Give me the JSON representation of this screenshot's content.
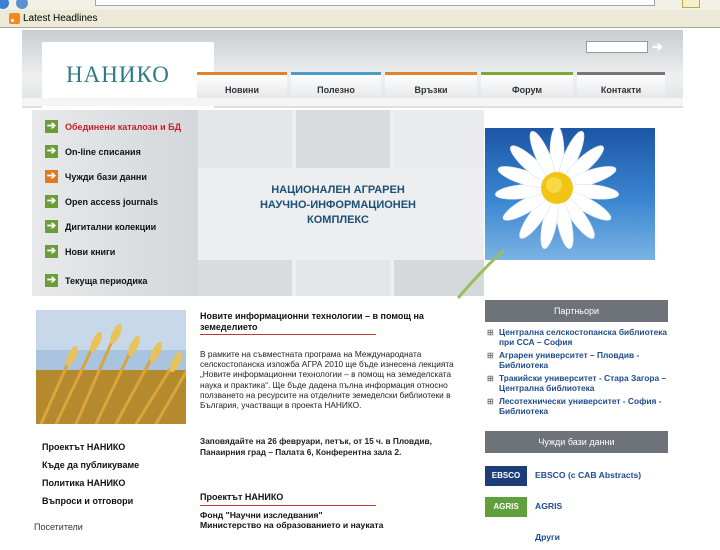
{
  "browser": {
    "favorites_link": "Latest Headlines"
  },
  "site": {
    "logo": "НАНИКО",
    "nav": [
      {
        "label": "Новини",
        "color": "#e0832a"
      },
      {
        "label": "Полезно",
        "color": "#4b9cc6"
      },
      {
        "label": "Връзки",
        "color": "#e0832a"
      },
      {
        "label": "Форум",
        "color": "#7aaa3a"
      },
      {
        "label": "Контакти",
        "color": "#777777"
      }
    ],
    "menu": [
      {
        "label": "Обединени каталози и БД",
        "icon": "arrow-right-icon",
        "color": "#c8202a",
        "arrow_color": "#6a9d3a"
      },
      {
        "label": "On-line списания",
        "icon": "arrow-right-icon",
        "color": "#111111",
        "arrow_color": "#6a9d3a"
      },
      {
        "label": "Чужди бази данни",
        "icon": "arrow-right-icon",
        "color": "#111111",
        "arrow_color": "#e07a1f"
      },
      {
        "label": "Open access journals",
        "icon": "arrow-right-icon",
        "color": "#111111",
        "arrow_color": "#6a9d3a"
      },
      {
        "label": "Дигитални колекции",
        "icon": "arrow-right-icon",
        "color": "#111111",
        "arrow_color": "#6a9d3a"
      },
      {
        "label": "Нови книги",
        "icon": "arrow-right-icon",
        "color": "#111111",
        "arrow_color": "#6a9d3a"
      },
      {
        "label": "Текуща периодика",
        "icon": "arrow-right-icon",
        "color": "#111111",
        "arrow_color": "#6a9d3a"
      }
    ],
    "banner": {
      "line1": "НАЦИОНАЛЕН АГРАРЕН",
      "line2": "НАУЧНО-ИНФОРМАЦИОНЕН",
      "line3": "КОМПЛЕКС"
    },
    "side_links": [
      "Проектът НАНИКО",
      "Къде да публикуваме",
      "Политика НАНИКО",
      "Въпроси и отговори"
    ],
    "bottom_left": "Посетители",
    "news": {
      "title": "Новите информационни технологии – в помощ на земеделието",
      "body": "В рамките на съвместната програма на Международната селскостопанска изложба АГРА 2010 ще бъде изнесена лекцията „Новите информационни технологии – в помощ на земеделската наука и практика“. Ще бъде дадена пълна информация относно ползването на ресурсите на отделните земеделски библиотеки в България, участващи в проекта НАНИКО.",
      "note": "Заповядайте на 26 февруари, петък, от 15 ч. в Пловдив, Панаирния град – Палата 6, Конферентна зала 2."
    },
    "project": {
      "title": "Проектът НАНИКО",
      "line1": "Фонд \"Научни изследвания\"",
      "line2": "Министерство на образованието и науката"
    },
    "partners": {
      "header": "Партньори",
      "items": [
        "Централна селскостопанска библиотека при ССА – София",
        "Аграрен университет – Пловдив - Библиотека",
        "Тракийски университет - Стара Загора – Централна библиотека",
        "Лесотехнически университет - София - Библиотека"
      ]
    },
    "databases": {
      "header": "Чужди бази данни",
      "items": [
        {
          "logo": "EBSCO",
          "name": "EBSCO (с CAB Abstracts)"
        },
        {
          "logo": "AGRIS",
          "name": "AGRIS"
        },
        {
          "logo": "",
          "name": "Други"
        }
      ]
    },
    "colors": {
      "accent_red": "#c33333",
      "link_blue": "#1e4b8c",
      "panel_gray": "#6d7379"
    }
  }
}
